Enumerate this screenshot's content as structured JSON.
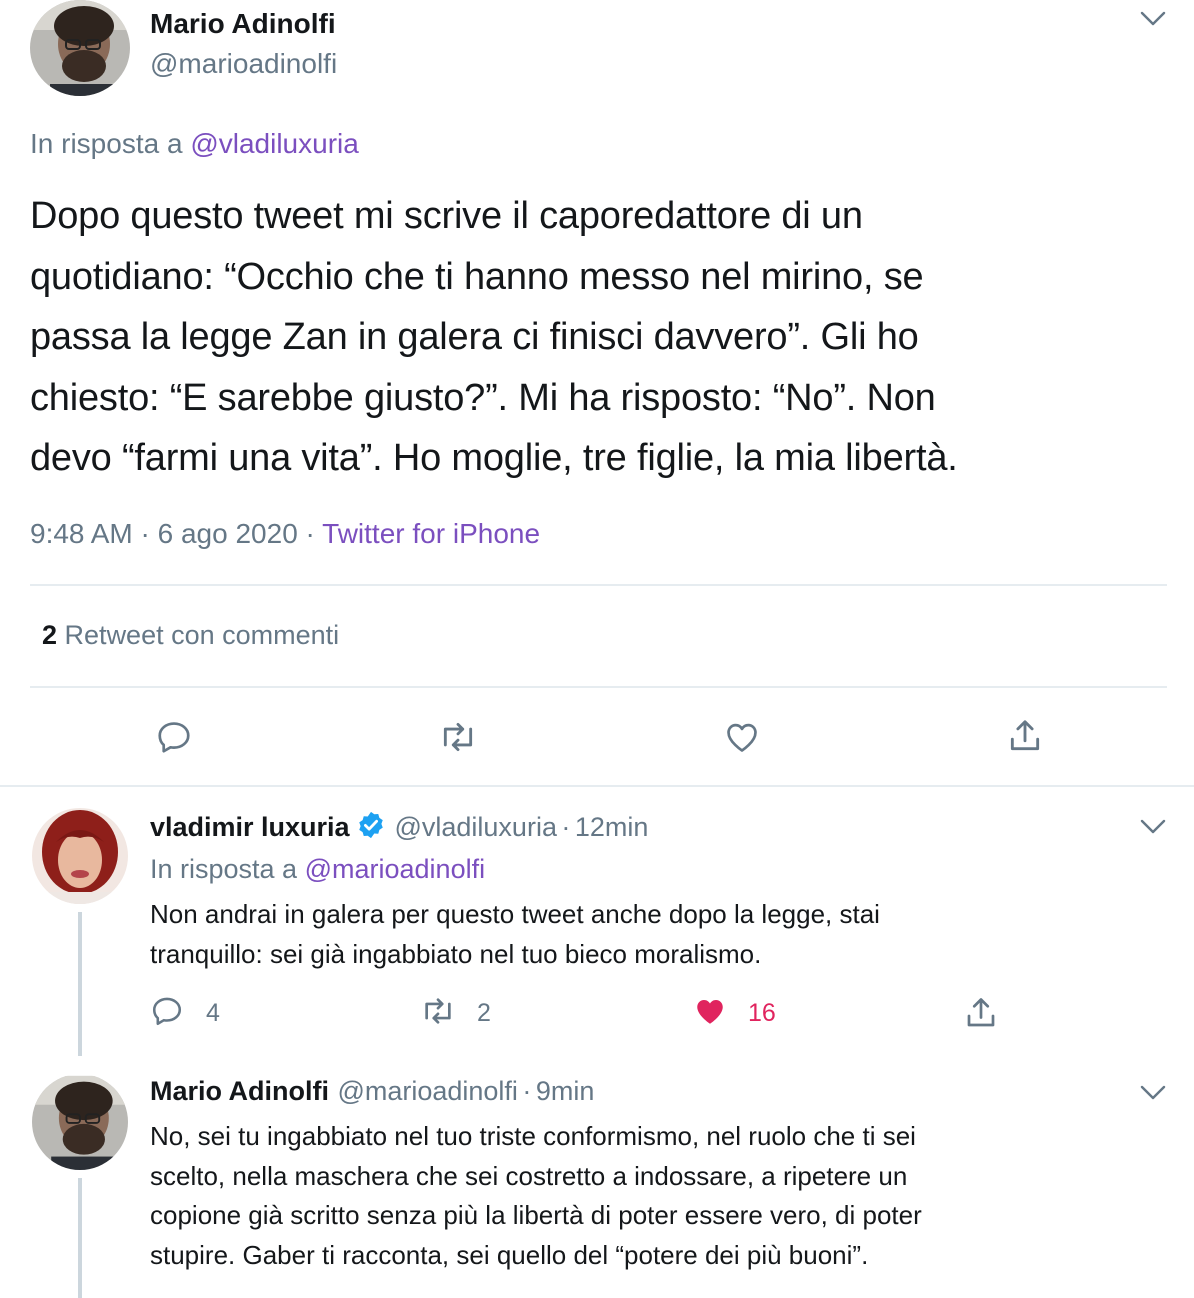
{
  "main_tweet": {
    "author_name": "Mario Adinolfi",
    "author_handle": "@marioadinolfi",
    "reply_to_prefix": "In risposta a",
    "reply_to_handle": "@vladiluxuria",
    "text_lines": [
      "Dopo questo tweet mi scrive il caporedattore di un",
      "quotidiano: “Occhio che ti hanno messo nel mirino, se",
      "passa la legge Zan in galera ci finisci davvero”. Gli ho",
      "chiesto: “E sarebbe giusto?”. Mi ha risposto: “No”. Non",
      "devo “farmi una vita”. Ho moglie, tre figlie, la mia libertà."
    ],
    "time": "9:48 AM",
    "separator": "·",
    "date": "6 ago 2020",
    "source": "Twitter for iPhone",
    "retweet_count": "2",
    "retweet_label": "Retweet con commenti"
  },
  "reply_1": {
    "author_name": "vladimir luxuria",
    "verified": true,
    "author_handle": "@vladiluxuria",
    "separator": "·",
    "age": "12min",
    "reply_to_prefix": "In risposta a",
    "reply_to_handle": "@marioadinolfi",
    "text_lines": [
      "Non andrai in galera per questo tweet anche dopo la legge, stai",
      "tranquillo: sei già ingabbiato nel tuo bieco moralismo."
    ],
    "reply_count": "4",
    "retweet_count": "2",
    "like_count": "16"
  },
  "reply_2": {
    "author_name": "Mario Adinolfi",
    "author_handle": "@marioadinolfi",
    "separator": "·",
    "age": "9min",
    "text_lines": [
      "No, sei tu ingabbiato nel tuo triste conformismo, nel ruolo che ti sei",
      "scelto, nella maschera che sei costretto a indossare, a ripetere un",
      "copione già scritto senza più la libertà di poter essere vero, di poter",
      "stupire. Gaber ti racconta, sei quello del “potere dei più buoni”."
    ]
  },
  "icons": {
    "reply": "reply-icon",
    "retweet": "retweet-icon",
    "like": "heart-icon",
    "share": "share-icon",
    "more": "chevron-down-icon",
    "verified": "verified-badge-icon"
  },
  "colors": {
    "accent_link": "#7b4fbf",
    "muted": "#657786",
    "liked": "#e0245e",
    "verified": "#1da1f2",
    "divider": "#e6ecf0"
  }
}
